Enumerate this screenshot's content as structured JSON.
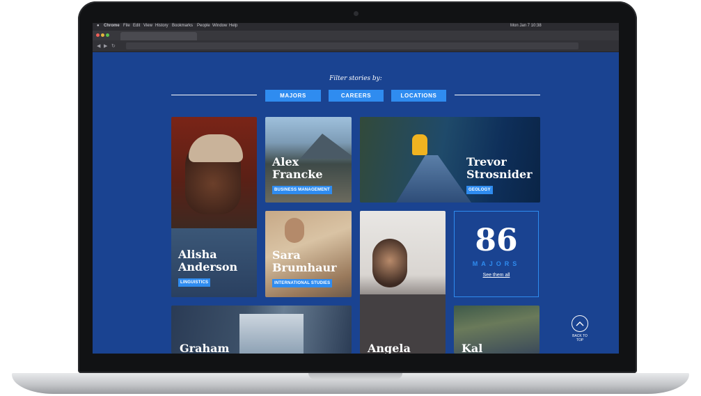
{
  "browser": {
    "menu_items": [
      "Chrome",
      "File",
      "Edit",
      "View",
      "History",
      "Bookmarks",
      "People",
      "Window",
      "Help"
    ],
    "clock": "Mon Jan 7 10:38"
  },
  "page": {
    "filter_heading": "Filter stories by:",
    "filters": [
      "MAJORS",
      "CAREERS",
      "LOCATIONS"
    ],
    "stories": [
      {
        "name_line1": "Alisha",
        "name_line2": "Anderson",
        "tag": "LINGUISTICS"
      },
      {
        "name_line1": "Alex",
        "name_line2": "Francke",
        "tag": "BUSINESS MANAGEMENT"
      },
      {
        "name_line1": "Trevor",
        "name_line2": "Strosnider",
        "tag": "GEOLOGY"
      },
      {
        "name_line1": "Sara",
        "name_line2": "Brumhaur",
        "tag": "INTERNATIONAL STUDIES"
      },
      {
        "name_line1": "Graham",
        "name_line2": "",
        "tag": ""
      },
      {
        "name_line1": "Angela",
        "name_line2": "",
        "tag": ""
      },
      {
        "name_line1": "Kal",
        "name_line2": "",
        "tag": ""
      }
    ],
    "stat": {
      "number": "86",
      "label": "MAJORS",
      "link": "See them all"
    },
    "back_to_top": {
      "line1": "BACK TO",
      "line2": "TOP"
    }
  },
  "colors": {
    "page_bg": "#1a4391",
    "accent": "#2f8cf0"
  }
}
